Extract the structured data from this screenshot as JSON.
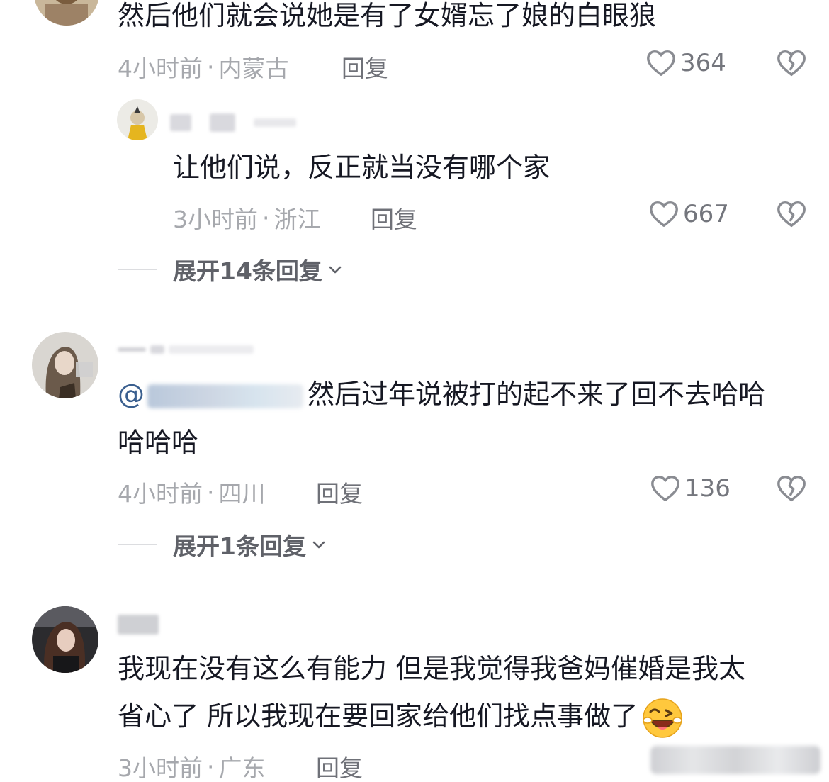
{
  "comments": [
    {
      "text": "然后他们就会说她是有了女婿忘了娘的白眼狼",
      "time": "4小时前",
      "location": "内蒙古",
      "reply_label": "回复",
      "likes": "364"
    },
    {
      "text": "让他们说，反正就当没有哪个家",
      "time": "3小时前",
      "location": "浙江",
      "reply_label": "回复",
      "likes": "667"
    },
    {
      "mention_prefix": "@",
      "text": "然后过年说被打的起不来了回不去哈哈",
      "text_line2": "哈哈哈",
      "time": "4小时前",
      "location": "四川",
      "reply_label": "回复",
      "likes": "136"
    },
    {
      "text": "我现在没有这么有能力 但是我觉得我爸妈催婚是我太",
      "text_line2": "省心了 所以我现在要回家给他们找点事做了",
      "time": "3小时前",
      "location": "广东",
      "reply_label": "回复"
    }
  ],
  "expand_replies": [
    {
      "label": "展开14条回复"
    },
    {
      "label": "展开1条回复"
    }
  ],
  "meta_separator": "·",
  "icons": {
    "like": "heart-outline-icon",
    "dislike": "broken-heart-icon",
    "expand": "chevron-down-icon",
    "emoji": "wink-laugh-emoji"
  },
  "colors": {
    "text": "#161823",
    "meta": "#a6a8ad",
    "mention": "#3a5f8f"
  }
}
